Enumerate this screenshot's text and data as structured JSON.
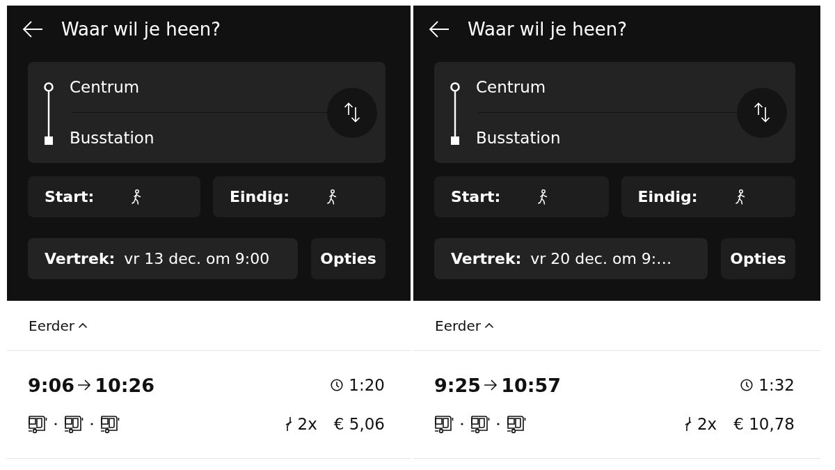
{
  "panels": [
    {
      "header": {
        "title": "Waar wil je heen?"
      },
      "route": {
        "from": "Centrum",
        "to": "Busstation"
      },
      "trip_ends": [
        {
          "label": "Start:",
          "kind": "walk"
        },
        {
          "label": "Eindig:",
          "kind": "walk"
        }
      ],
      "departure": {
        "label": "Vertrek:",
        "value": "vr 13 dec. om 9:00"
      },
      "options_button": "Opties",
      "earlier_link": "Eerder",
      "trips": [
        {
          "departure": "9:06",
          "arrival": "10:26",
          "duration": "1:20",
          "legs": [
            {
              "kind": "bus"
            },
            {
              "kind": "bus"
            },
            {
              "kind": "bus"
            }
          ],
          "transfers": "2x",
          "price": "€ 5,06"
        }
      ]
    },
    {
      "header": {
        "title": "Waar wil je heen?"
      },
      "route": {
        "from": "Centrum",
        "to": "Busstation"
      },
      "trip_ends": [
        {
          "label": "Start:",
          "kind": "walk"
        },
        {
          "label": "Eindig:",
          "kind": "walk"
        }
      ],
      "departure": {
        "label": "Vertrek:",
        "value": "vr 20 dec. om 9:…"
      },
      "options_button": "Opties",
      "earlier_link": "Eerder",
      "trips": [
        {
          "departure": "9:25",
          "arrival": "10:57",
          "duration": "1:32",
          "legs": [
            {
              "kind": "bus"
            },
            {
              "kind": "bus"
            },
            {
              "kind": "bus"
            }
          ],
          "transfers": "2x",
          "price": "€ 10,78"
        }
      ]
    }
  ]
}
